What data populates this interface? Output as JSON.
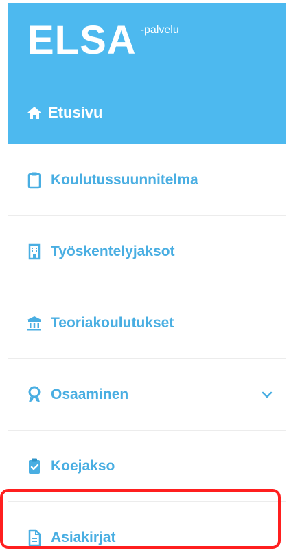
{
  "brand": {
    "name": "ELSA",
    "suffix": "-palvelu"
  },
  "nav": {
    "home": {
      "label": "Etusivu",
      "icon": "home-icon"
    },
    "items": [
      {
        "label": "Koulutussuunnitelma",
        "icon": "clipboard-icon"
      },
      {
        "label": "Työskentelyjaksot",
        "icon": "building-icon"
      },
      {
        "label": "Teoriakoulutukset",
        "icon": "university-icon"
      },
      {
        "label": "Osaaminen",
        "icon": "award-icon",
        "expandable": true
      },
      {
        "label": "Koejakso",
        "icon": "clipboard-check-icon"
      },
      {
        "label": "Asiakirjat",
        "icon": "document-icon",
        "highlighted": true
      }
    ]
  },
  "colors": {
    "header_bg": "#4db9ef",
    "text_accent": "#49aee2",
    "highlight": "#ff1f1f"
  }
}
